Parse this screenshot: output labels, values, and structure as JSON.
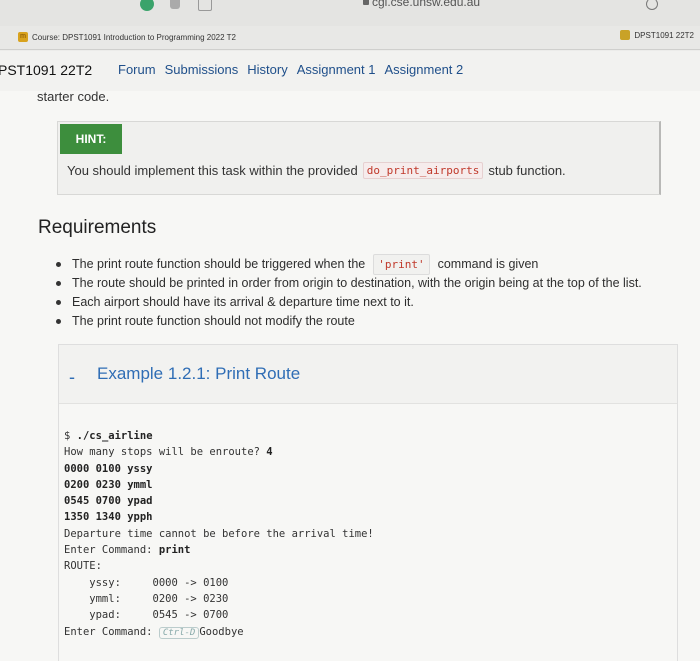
{
  "browser": {
    "url": "cgi.cse.unsw.edu.au",
    "tab_left_title": "Course: DPST1091 Introduction to Programming 2022 T2",
    "tab_right_title": "DPST1091 22T2"
  },
  "course_nav": {
    "code": "PST1091 22T2",
    "links": [
      "Forum",
      "Submissions",
      "History",
      "Assignment 1",
      "Assignment 2"
    ]
  },
  "content": {
    "starter_text": "starter code.",
    "hint": {
      "title": "HINT:",
      "text_before": "You should implement this task within the provided",
      "code": "do_print_airports",
      "text_after": "stub function."
    },
    "requirements": {
      "heading": "Requirements",
      "item1_before": "The print route function should be triggered when the",
      "item1_code": "'print'",
      "item1_after": "command is given",
      "item2": "The route should be printed in order from origin to destination, with the origin being at the top of the list.",
      "item3": "Each airport should have its arrival & departure time next to it.",
      "item4": "The print route function should not modify the route"
    },
    "example": {
      "collapse_symbol": "-",
      "title": "Example 1.2.1: Print Route",
      "terminal": {
        "prompt": "$ ",
        "cmd": "./cs_airline",
        "q_label": "How many stops will be enroute? ",
        "q_answer": "4",
        "in1": "0000 0100 yssy",
        "in2": "0200 0230 ymml",
        "in3": "0545 0700 ypad",
        "in4": "1350 1340 ypph",
        "error": "Departure time cannot be before the arrival time!",
        "enter_label": "Enter Command: ",
        "enter_cmd": "print",
        "route_label": "ROUTE:",
        "r1": "    yssy:     0000 -> 0100",
        "r2": "    ymml:     0200 -> 0230",
        "r3": "    ypad:     0545 -> 0700",
        "enter_label2": "Enter Command: ",
        "ctrl_key": "Ctrl-D",
        "goodbye": "Goodbye"
      }
    }
  }
}
